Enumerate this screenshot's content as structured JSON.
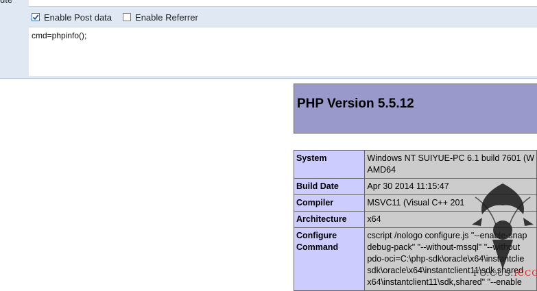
{
  "hackbar": {
    "cut_label": "ute",
    "enable_post": {
      "label": "Enable Post data",
      "checked": true
    },
    "enable_referrer": {
      "label": "Enable Referrer",
      "checked": false
    },
    "post_data": "cmd=phpinfo();"
  },
  "phpinfo": {
    "title": "PHP Version 5.5.12",
    "rows": [
      {
        "key": "System",
        "lines": [
          "Windows NT SUIYUE-PC 6.1 build 7601 (W",
          "AMD64"
        ]
      },
      {
        "key": "Build Date",
        "lines": [
          "Apr 30 2014 11:15:47"
        ]
      },
      {
        "key": "Compiler",
        "lines": [
          "MSVC11 (Visual C++ 201"
        ]
      },
      {
        "key": "Architecture",
        "lines": [
          "x64"
        ]
      },
      {
        "key": "Configure Command",
        "lines": [
          "cscript /nologo configure.js \"--enable-snap",
          "debug-pack\" \"--without-mssql\" \"--without",
          "pdo-oci=C:\\php-sdk\\oracle\\x64\\instantclie",
          "sdk\\oracle\\x64\\instantclient11\\sdk,shared",
          "x64\\instantclient11\\sdk,shared\" \"--enable"
        ]
      }
    ]
  },
  "watermark": {
    "text_main": "FO.CUS.",
    "text_accent": "ICCG"
  },
  "colors": {
    "php_header": "#9999cc",
    "row_key_bg": "#ccccff",
    "row_value_bg": "#cccccc",
    "topbar_bg": "#dfe8f3",
    "checkbox_tick": "#1f4f9a"
  }
}
